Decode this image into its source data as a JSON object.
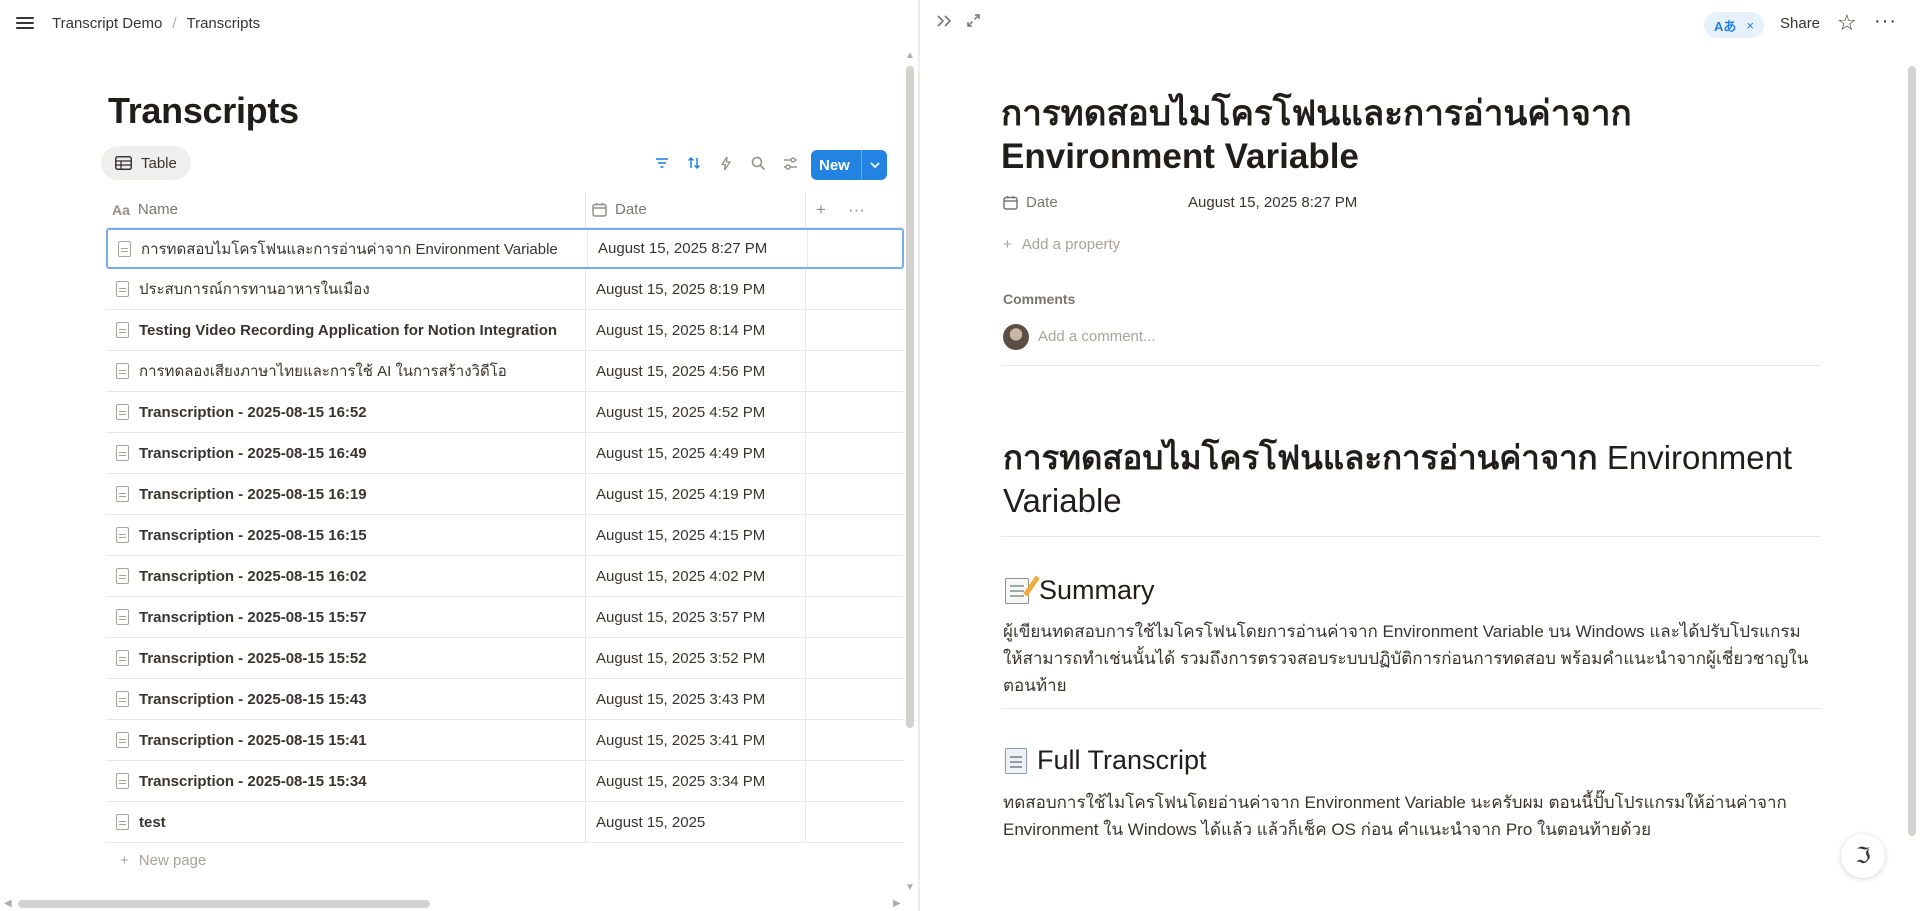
{
  "breadcrumb": {
    "workspace": "Transcript Demo",
    "page": "Transcripts"
  },
  "database": {
    "title": "Transcripts",
    "view_label": "Table",
    "new_label": "New",
    "columns": {
      "name": "Name",
      "date": "Date"
    },
    "rows": [
      {
        "name": "การทดสอบไมโครโฟนและการอ่านค่าจาก Environment Variable",
        "date": "August 15, 2025 8:27 PM",
        "selected": true
      },
      {
        "name": "ประสบการณ์การทานอาหารในเมือง",
        "date": "August 15, 2025 8:19 PM"
      },
      {
        "name": "Testing Video Recording Application for Notion Integration",
        "date": "August 15, 2025 8:14 PM"
      },
      {
        "name": "การทดลองเสียงภาษาไทยและการใช้ AI ในการสร้างวิดีโอ",
        "date": "August 15, 2025 4:56 PM"
      },
      {
        "name": "Transcription - 2025-08-15 16:52",
        "date": "August 15, 2025 4:52 PM"
      },
      {
        "name": "Transcription - 2025-08-15 16:49",
        "date": "August 15, 2025 4:49 PM"
      },
      {
        "name": "Transcription - 2025-08-15 16:19",
        "date": "August 15, 2025 4:19 PM"
      },
      {
        "name": "Transcription - 2025-08-15 16:15",
        "date": "August 15, 2025 4:15 PM"
      },
      {
        "name": "Transcription - 2025-08-15 16:02",
        "date": "August 15, 2025 4:02 PM"
      },
      {
        "name": "Transcription - 2025-08-15 15:57",
        "date": "August 15, 2025 3:57 PM"
      },
      {
        "name": "Transcription - 2025-08-15 15:52",
        "date": "August 15, 2025 3:52 PM"
      },
      {
        "name": "Transcription - 2025-08-15 15:43",
        "date": "August 15, 2025 3:43 PM"
      },
      {
        "name": "Transcription - 2025-08-15 15:41",
        "date": "August 15, 2025 3:41 PM"
      },
      {
        "name": "Transcription - 2025-08-15 15:34",
        "date": "August 15, 2025 3:34 PM"
      },
      {
        "name": "test",
        "date": "August 15, 2025"
      }
    ],
    "new_page_label": "New page"
  },
  "detail": {
    "lang_chip": "Aあ",
    "share_label": "Share",
    "title": "การทดสอบไมโครโฟนและการอ่านค่าจาก Environment Variable",
    "property": {
      "label": "Date",
      "value": "August 15, 2025 8:27 PM"
    },
    "add_property_label": "Add a property",
    "comments_label": "Comments",
    "comment_placeholder": "Add a comment...",
    "heading_thai": "การทดสอบไมโครโฟนและการอ่านค่าจาก",
    "heading_en": "Environment Variable",
    "summary_heading": "Summary",
    "summary_text": "ผู้เขียนทดสอบการใช้ไมโครโฟนโดยการอ่านค่าจาก Environment Variable บน Windows และได้ปรับโปรแกรมให้สามารถทำเช่นนั้นได้ รวมถึงการตรวจสอบระบบปฏิบัติการก่อนการทดสอบ พร้อมคำแนะนำจากผู้เชี่ยวชาญในตอนท้าย",
    "transcript_heading": "Full Transcript",
    "transcript_text": "ทดสอบการใช้ไมโครโฟนโดยอ่านค่าจาก Environment Variable นะครับผม ตอนนี้ปั๊บโปรแกรมให้อ่านค่าจาก Environment ใน Windows ได้แล้ว แล้วก็เช็ค OS ก่อน คำแนะนำจาก Pro ในตอนท้ายด้วย"
  },
  "icons": {
    "menu": "hamburger-icon",
    "table": "table-icon",
    "filter": "filter-icon",
    "sort": "sort-icon",
    "automation": "lightning-icon",
    "search": "search-icon",
    "settings": "sliders-icon",
    "name_col": "text-aa-icon",
    "date_col": "calendar-icon",
    "page": "page-icon"
  },
  "colors": {
    "accent": "#2383e2",
    "text": "#37352f",
    "muted": "#787774",
    "border": "#e9e9e7"
  }
}
